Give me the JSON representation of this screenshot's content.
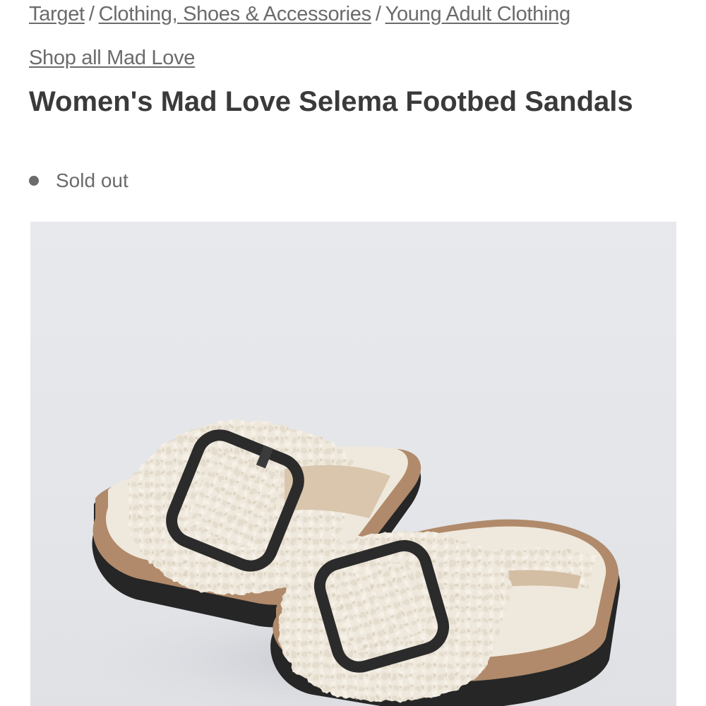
{
  "breadcrumb": {
    "items": [
      {
        "label": "Target"
      },
      {
        "label": "Clothing, Shoes & Accessories"
      },
      {
        "label": "Young Adult Clothing"
      }
    ],
    "separator": "/"
  },
  "shop_all_link": "Shop all Mad Love",
  "product": {
    "title": "Women's Mad Love Selema Footbed Sandals",
    "availability": "Sold out",
    "image_alt_icon": "sandals-product-image"
  },
  "colors": {
    "text_muted": "#6b6b6b",
    "title": "#3a3a3a",
    "image_bg": "#e5e7ea",
    "sherpa": "#efe8dc",
    "cork": "#b08a6a",
    "sole": "#262626",
    "buckle": "#2b2b2b"
  }
}
